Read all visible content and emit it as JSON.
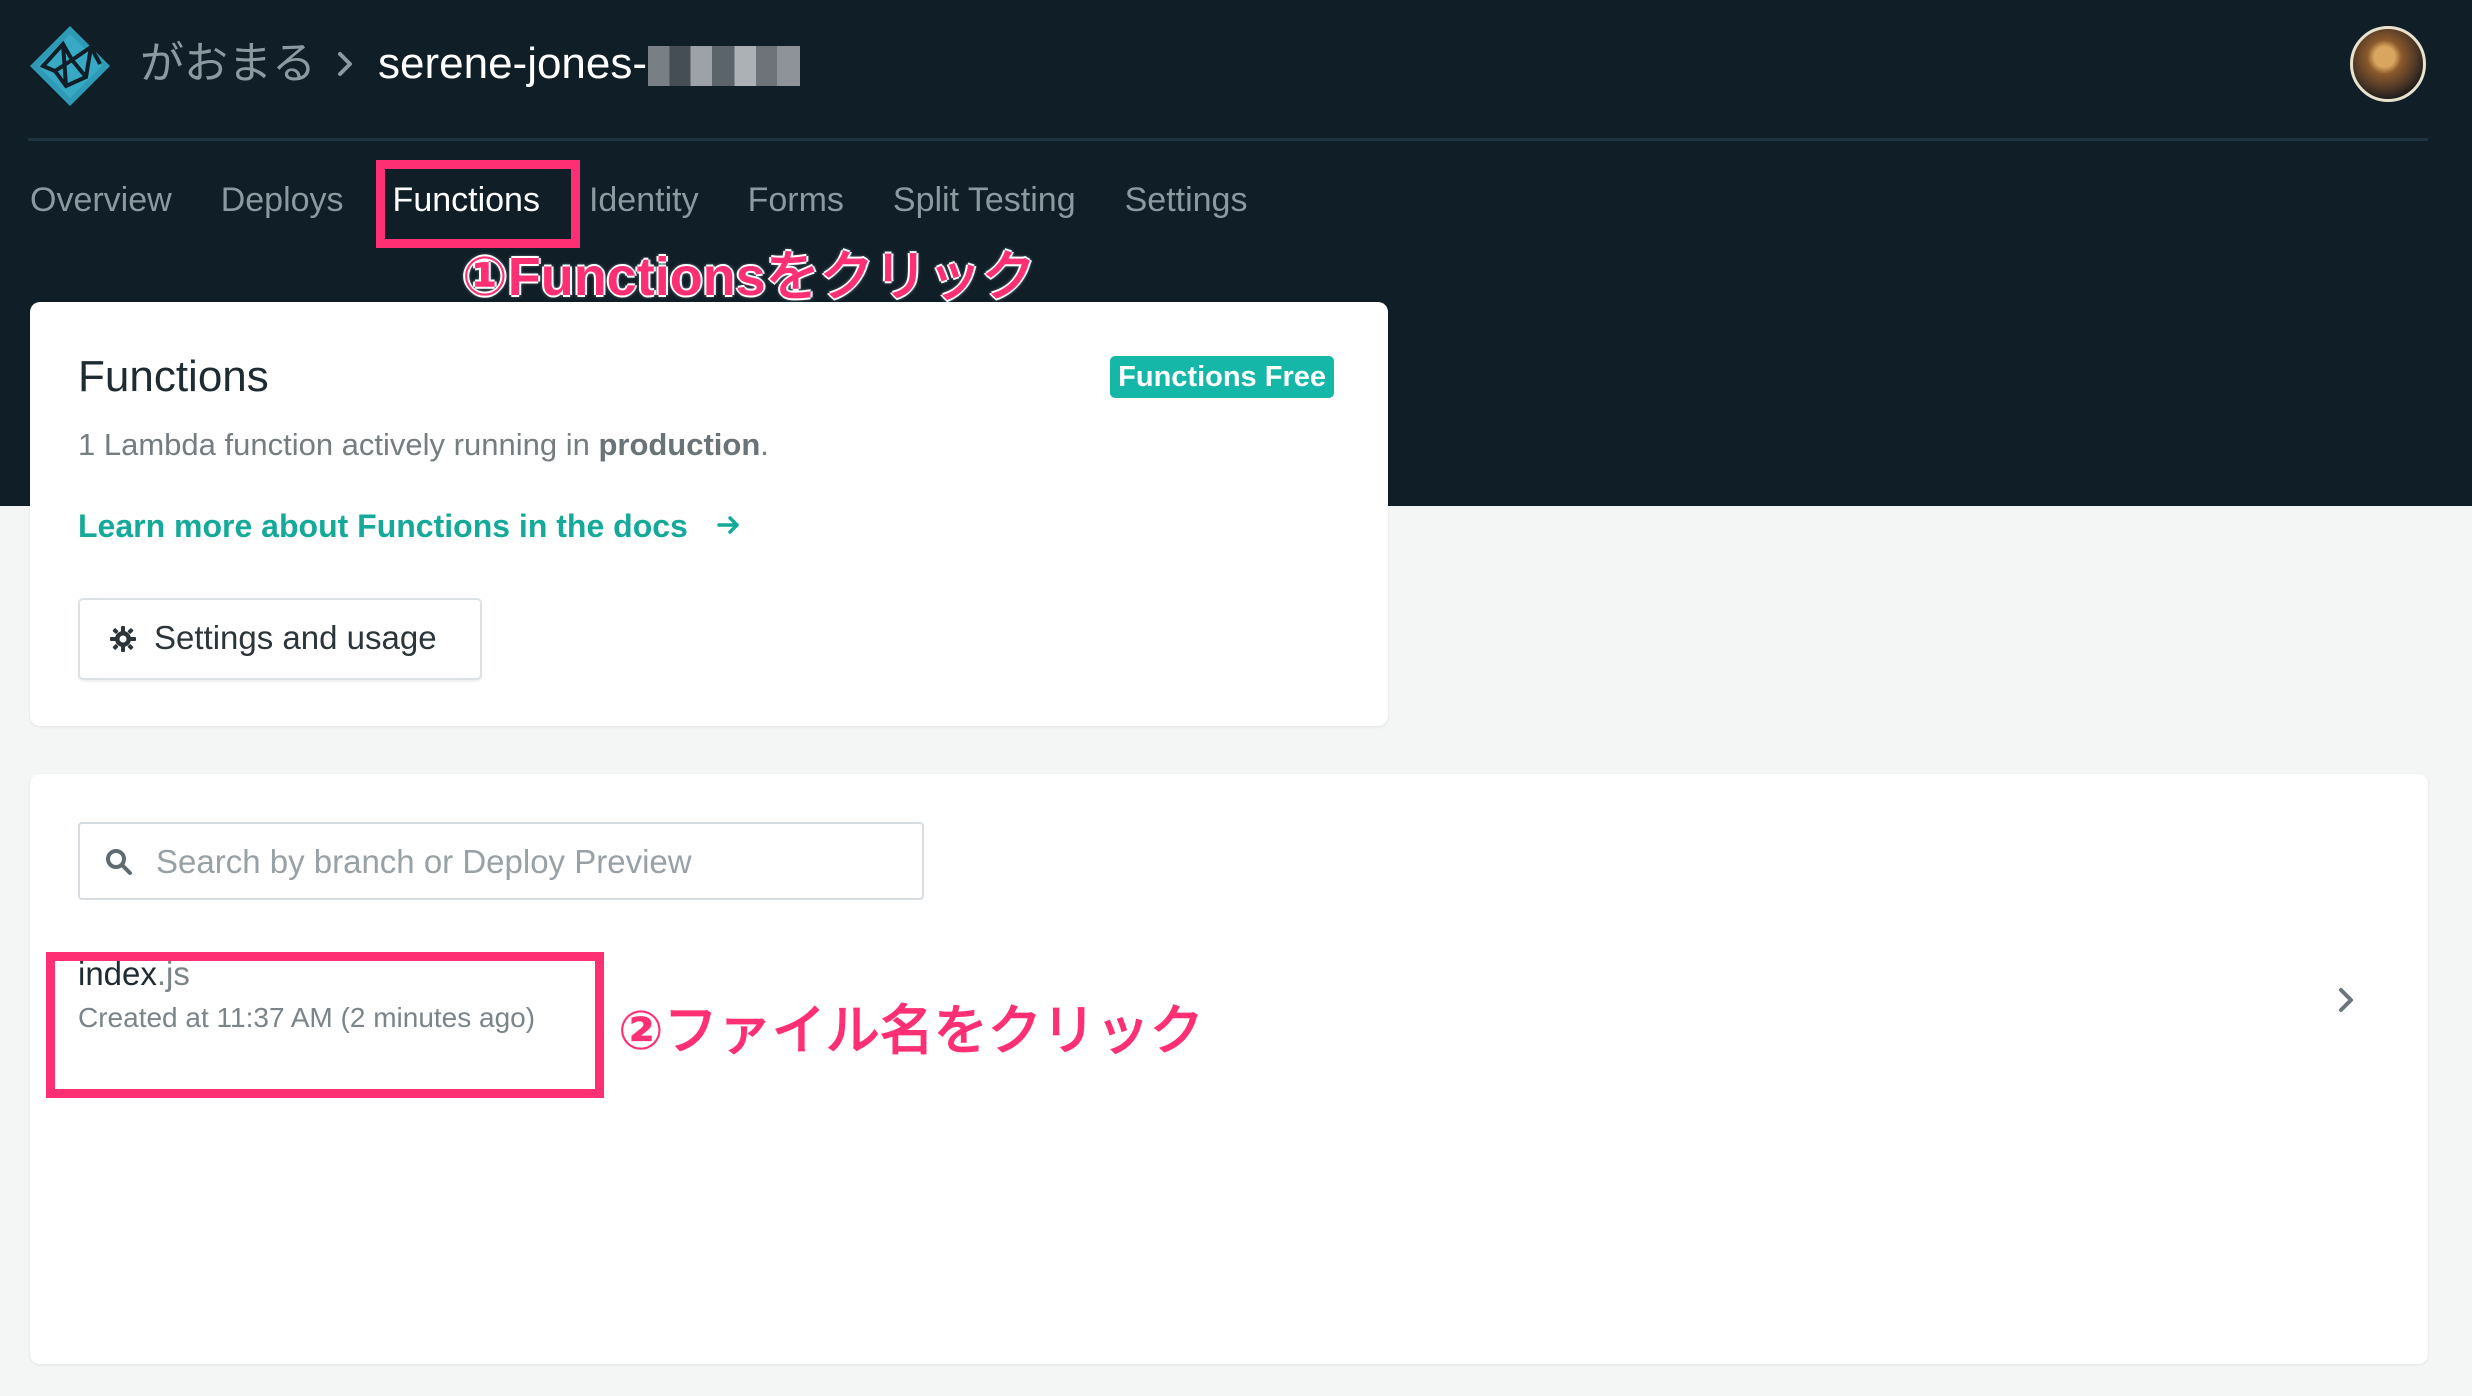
{
  "colors": {
    "header_background": "#0f1e27",
    "page_background": "#f4f6f6",
    "card_background": "#ffffff",
    "accent": "#15b7a8",
    "annotation": "#ff2f73"
  },
  "header": {
    "team_name": "がおまる",
    "site_name": "serene-jones-"
  },
  "nav": {
    "items": [
      {
        "label": "Overview",
        "active": false
      },
      {
        "label": "Deploys",
        "active": false
      },
      {
        "label": "Functions",
        "active": true
      },
      {
        "label": "Identity",
        "active": false
      },
      {
        "label": "Forms",
        "active": false
      },
      {
        "label": "Split Testing",
        "active": false
      },
      {
        "label": "Settings",
        "active": false
      }
    ]
  },
  "annotations": {
    "step_1": "①Functionsをクリック",
    "step_2": "②ファイル名をクリック"
  },
  "functions_card": {
    "title": "Functions",
    "plan_badge": "Functions Free",
    "description_prefix": "1 Lambda function actively running in ",
    "description_emphasis": "production",
    "description_suffix": ".",
    "docs_link": "Learn more about Functions in the docs",
    "settings_button": "Settings and usage"
  },
  "search": {
    "placeholder": "Search by branch or Deploy Preview",
    "value": ""
  },
  "functions_list": [
    {
      "file_base": "index",
      "file_ext": ".js",
      "created": "Created at 11:37 AM (2 minutes ago)"
    }
  ],
  "icons": {
    "logo": "netlify-logo-icon",
    "breadcrumb_separator": "chevron-right-icon",
    "docs_link": "arrow-right-icon",
    "settings": "gear-icon",
    "search": "search-icon",
    "row_chevron": "chevron-right-icon"
  }
}
